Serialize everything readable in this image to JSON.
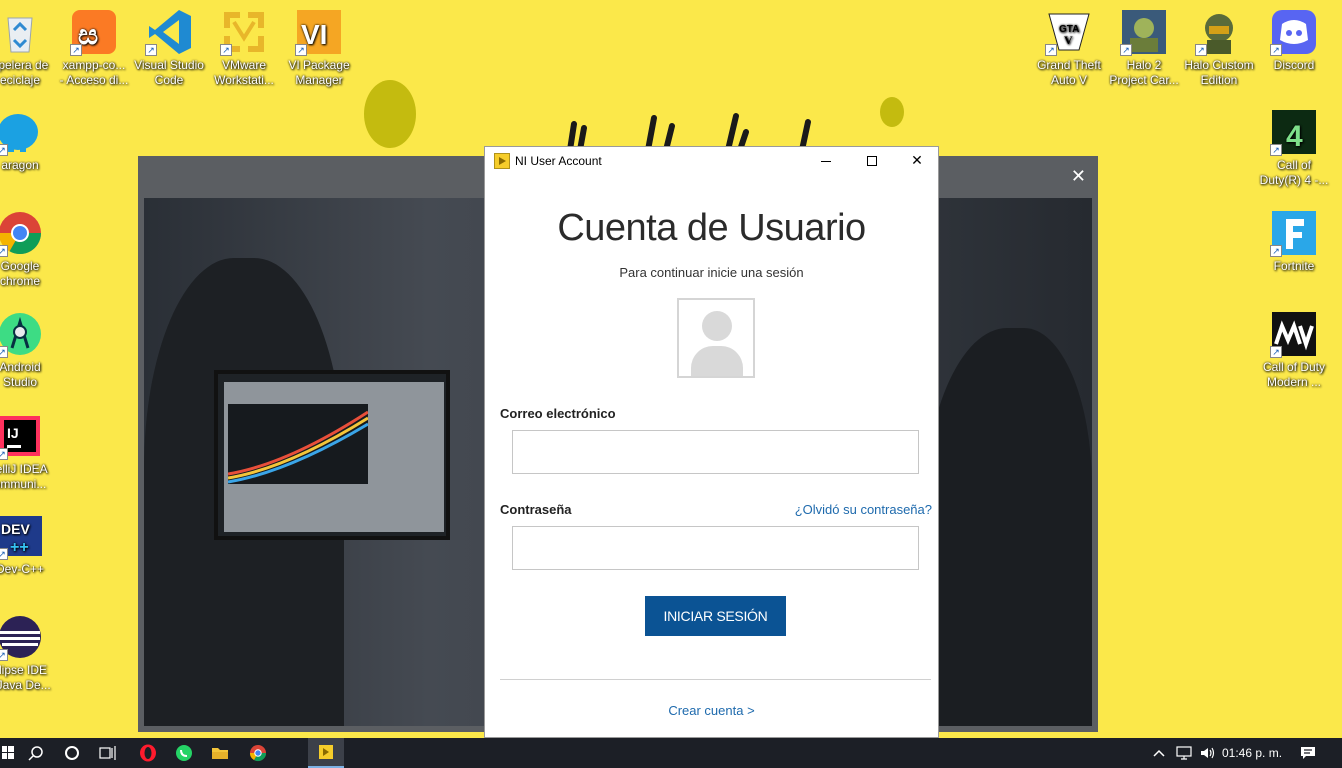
{
  "desktop": {
    "left_icons": [
      {
        "label": "Papelera de reciclaje",
        "lines": [
          "apelera de",
          "eciclaje"
        ],
        "icon": "recycle-bin-icon",
        "color": "#d8d8d8"
      },
      {
        "label": "Laragon",
        "lines": [
          "aragon"
        ],
        "icon": "laragon-icon",
        "color": "#1ba1e2"
      },
      {
        "label": "Google Chrome",
        "lines": [
          "Google",
          "chrome"
        ],
        "icon": "chrome-icon",
        "color": "#db4437"
      },
      {
        "label": "Android Studio",
        "lines": [
          "Android",
          "Studio"
        ],
        "icon": "android-studio-icon",
        "color": "#3ddc84"
      },
      {
        "label": "IntelliJ IDEA Community",
        "lines": [
          "telliJ IDEA",
          "ommuni..."
        ],
        "icon": "intellij-icon",
        "color": "#000000"
      },
      {
        "label": "Dev-C++",
        "lines": [
          "Dev-C++"
        ],
        "icon": "devcpp-icon",
        "color": "#1e3a8a"
      },
      {
        "label": "Eclipse IDE for Java Developers",
        "lines": [
          "clipse IDE",
          "r Java De..."
        ],
        "icon": "eclipse-icon",
        "color": "#2c2255"
      }
    ],
    "top_icons": [
      {
        "lines": [
          "xampp-co...",
          "- Acceso di..."
        ],
        "icon": "xampp-icon",
        "color": "#fb7a24"
      },
      {
        "lines": [
          "Visual Studio",
          "Code"
        ],
        "icon": "vscode-icon",
        "color": "#1f8ad2"
      },
      {
        "lines": [
          "VMware",
          "Workstati..."
        ],
        "icon": "vmware-icon",
        "color": "#e8b62a"
      },
      {
        "lines": [
          "VI Package",
          "Manager"
        ],
        "icon": "vi-package-manager-icon",
        "color": "#f5a623"
      }
    ],
    "right_top_icons": [
      {
        "lines": [
          "Grand Theft",
          "Auto V"
        ],
        "icon": "gta-v-icon",
        "color": "#ffffff"
      },
      {
        "lines": [
          "Halo 2",
          "Project Car..."
        ],
        "icon": "halo2-icon",
        "color": "#3a5a7a"
      },
      {
        "lines": [
          "Halo Custom",
          "Edition"
        ],
        "icon": "halo-ce-icon",
        "color": "#5a6b3a"
      },
      {
        "lines": [
          "Discord"
        ],
        "icon": "discord-icon",
        "color": "#5865f2"
      }
    ],
    "right_icons": [
      {
        "lines": [
          "Call of",
          "Duty(R) 4 -..."
        ],
        "icon": "cod4-icon",
        "color": "#0c2a12"
      },
      {
        "lines": [
          "Fortnite"
        ],
        "icon": "fortnite-icon",
        "color": "#2aa7e8"
      },
      {
        "lines": [
          "Call of Duty",
          "Modern ..."
        ],
        "icon": "cod-mw-icon",
        "color": "#111111"
      }
    ],
    "wallpaper_color": "#fbe84a"
  },
  "launcher": {
    "close_glyph": "✕"
  },
  "dialog": {
    "window_title": "NI User Account",
    "heading": "Cuenta de Usuario",
    "subtitle": "Para continuar inicie una sesión",
    "email_label": "Correo electrónico",
    "email_value": "",
    "password_label": "Contraseña",
    "password_value": "",
    "forgot_link": "¿Olvidó su contraseña?",
    "login_button": "INICIAR SESIÓN",
    "create_account": "Crear cuenta >",
    "accent_color": "#0b5394",
    "link_color": "#1e6aad"
  },
  "taskbar": {
    "clock": "01:46 p. m.",
    "apps": [
      "start",
      "search",
      "task-view",
      "timeline",
      "opera",
      "whatsapp",
      "file-explorer",
      "chrome",
      "ni-user-account"
    ]
  }
}
